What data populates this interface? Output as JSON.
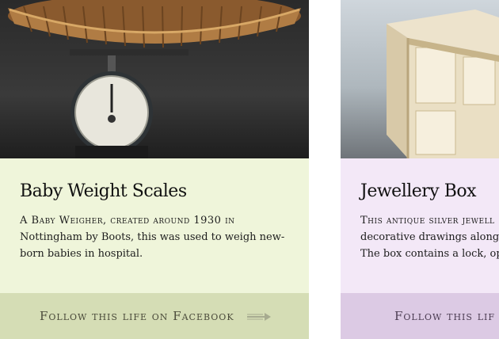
{
  "cards": [
    {
      "title": "Baby Weight Scales",
      "description_lead": "A Baby Weigher, created around 1930 in",
      "description_rest": "Nottingham by Boots, this was used to weigh new-born babies in hospital.",
      "follow_label": "Follow this life on Facebook",
      "colors": {
        "body": "#eff5da",
        "footer": "#d5ddb5"
      }
    },
    {
      "title": "Jewellery Box",
      "description_lead": "This antique silver jewell",
      "description_line2": "decorative drawings along its",
      "description_line3": "The box contains a lock, oper",
      "follow_label": "Follow this lif",
      "colors": {
        "body": "#f3e8f7",
        "footer": "#dccae4"
      }
    }
  ],
  "icons": {
    "arrow": "right-arrow-icon"
  }
}
